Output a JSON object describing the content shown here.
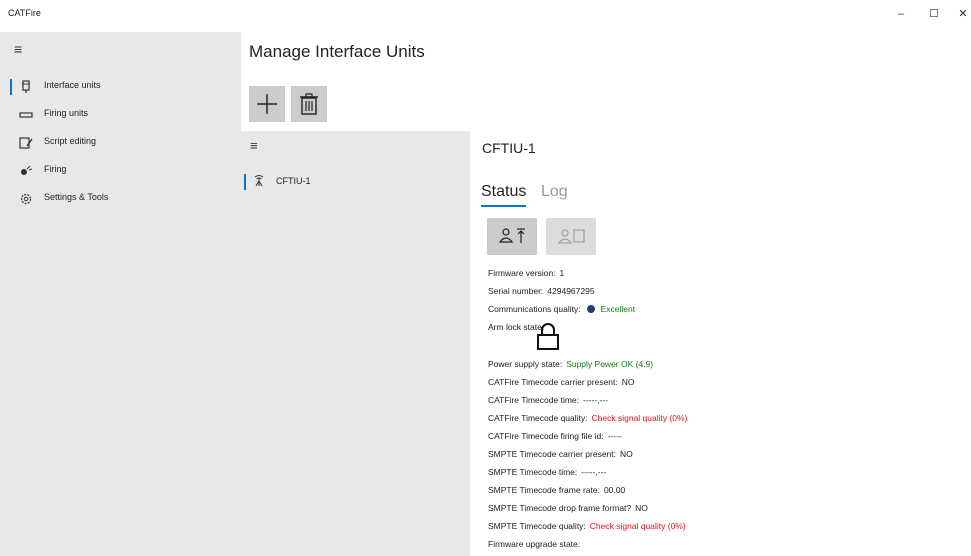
{
  "app": {
    "title": "CATFire"
  },
  "window_controls": {
    "minimize": "–",
    "maximize": "☐",
    "close": "✕"
  },
  "nav": {
    "items": [
      {
        "label": "Interface units",
        "icon": "interface-unit-icon",
        "selected": true
      },
      {
        "label": "Firing units",
        "icon": "firing-unit-icon",
        "selected": false
      },
      {
        "label": "Script editing",
        "icon": "script-edit-icon",
        "selected": false
      },
      {
        "label": "Firing",
        "icon": "firing-icon",
        "selected": false
      },
      {
        "label": "Settings & Tools",
        "icon": "gear-icon",
        "selected": false
      }
    ]
  },
  "page": {
    "title": "Manage Interface Units"
  },
  "toolbar": {
    "add_icon": "plus-icon",
    "delete_icon": "trash-icon"
  },
  "units_list": {
    "items": [
      {
        "label": "CFTIU-1",
        "icon": "antenna-icon",
        "selected": true
      }
    ]
  },
  "detail": {
    "title": "CFTIU-1",
    "tabs": {
      "status": "Status",
      "log": "Log"
    },
    "actions": {
      "arm_icon": "person-arm-icon",
      "disarm_icon": "person-stop-icon"
    },
    "fields": {
      "firmware_version": {
        "label": "Firmware version:",
        "value": "1"
      },
      "serial_number": {
        "label": "Serial number:",
        "value": "4294967295"
      },
      "comms_quality": {
        "label": "Communications quality:",
        "value": "Excellent"
      },
      "arm_lock": {
        "label": "Arm lock state:",
        "icon": "lock-icon"
      },
      "power_supply": {
        "label": "Power supply state:",
        "value": "Supply Power OK (4.9)"
      },
      "cat_carrier": {
        "label": "CATFire Timecode carrier present:",
        "value": "NO"
      },
      "cat_time": {
        "label": "CATFire Timecode time:",
        "value": "-----,---"
      },
      "cat_quality": {
        "label": "CATFire Timecode quality:",
        "value": "Check signal quality (0%)"
      },
      "cat_file_id": {
        "label": "CATFire Timecode firing file id:",
        "value": "-----"
      },
      "smpte_carrier": {
        "label": "SMPTE Timecode carrier present:",
        "value": "NO"
      },
      "smpte_time": {
        "label": "SMPTE Timecode time:",
        "value": "-----,---"
      },
      "smpte_frame_rate": {
        "label": "SMPTE Timecode frame rate:",
        "value": "00.00"
      },
      "smpte_drop_frame": {
        "label": "SMPTE Timecode drop frame format?",
        "value": "NO"
      },
      "smpte_quality": {
        "label": "SMPTE Timecode quality:",
        "value": "Check signal quality (0%)"
      },
      "firmware_upgrade": {
        "label": "Firmware upgrade state:",
        "value": ""
      }
    }
  },
  "colors": {
    "accent": "#0078d4",
    "ok": "#107c10",
    "error": "#e81123",
    "pane": "#e8e8e8"
  }
}
